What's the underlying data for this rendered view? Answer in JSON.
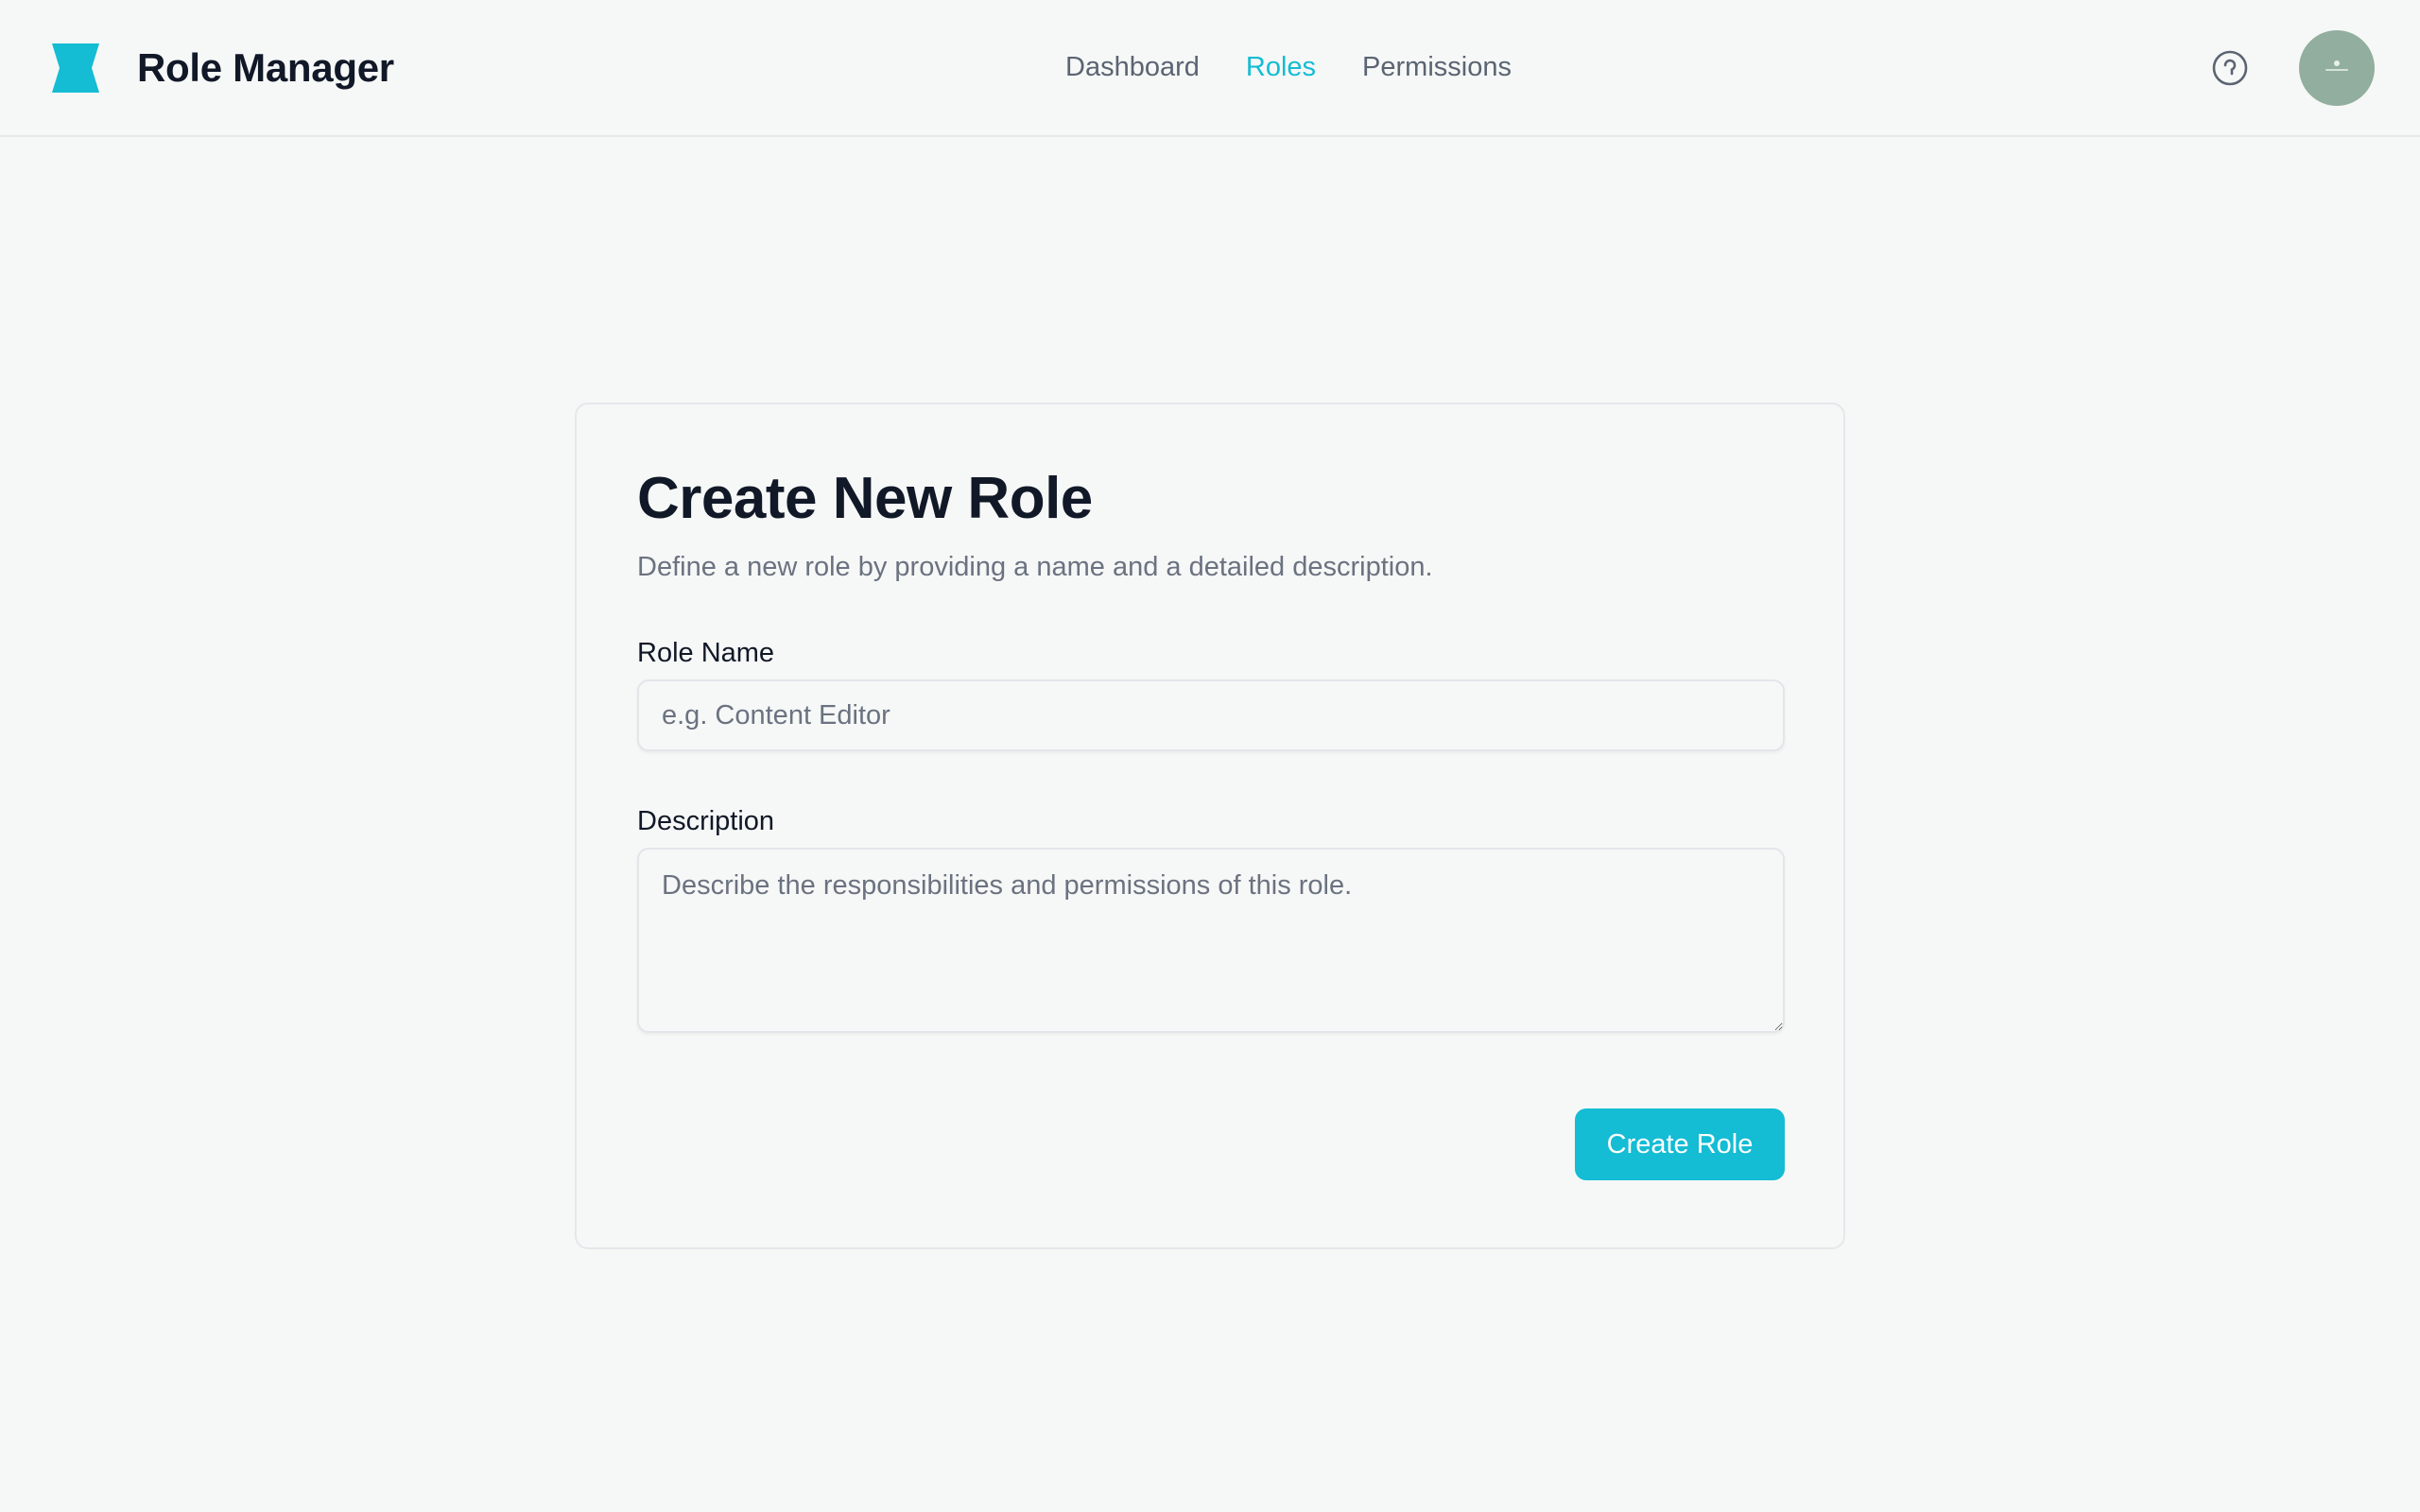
{
  "app": {
    "title": "Role Manager",
    "logo_icon": "hourglass-logo-icon",
    "accent_color": "#14bcd4"
  },
  "nav": {
    "items": [
      {
        "label": "Dashboard",
        "active": false
      },
      {
        "label": "Roles",
        "active": true
      },
      {
        "label": "Permissions",
        "active": false
      }
    ]
  },
  "header_actions": {
    "theme_icon": "theme-toggle-icon",
    "avatar_icon": "user-avatar"
  },
  "form": {
    "title": "Create New Role",
    "subtitle": "Define a new role by providing a name and a detailed description.",
    "role_name": {
      "label": "Role Name",
      "placeholder": "e.g. Content Editor",
      "value": ""
    },
    "description": {
      "label": "Description",
      "placeholder": "Describe the responsibilities and permissions of this role.",
      "value": ""
    },
    "submit_label": "Create Role"
  }
}
